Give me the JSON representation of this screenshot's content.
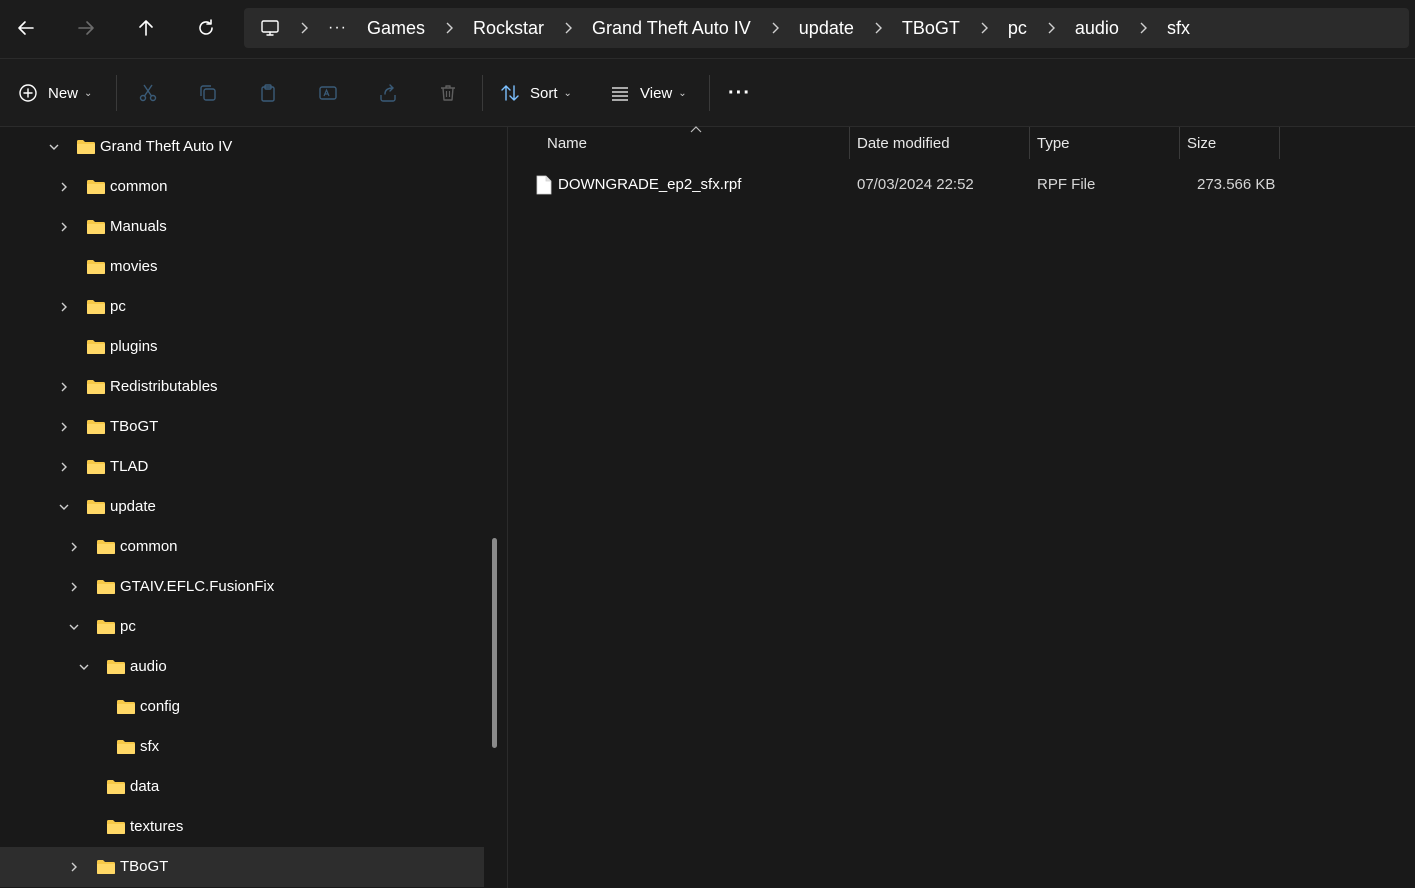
{
  "breadcrumb": {
    "more": "···",
    "items": [
      "Games",
      "Rockstar",
      "Grand Theft Auto IV",
      "update",
      "TBoGT",
      "pc",
      "audio",
      "sfx"
    ]
  },
  "toolbar": {
    "new_label": "New",
    "sort_label": "Sort",
    "view_label": "View",
    "more_label": "···"
  },
  "tree": [
    {
      "label": "Grand Theft Auto IV",
      "state": "expanded"
    },
    {
      "label": "common",
      "state": "collapsed"
    },
    {
      "label": "Manuals",
      "state": "collapsed"
    },
    {
      "label": "movies",
      "state": "none"
    },
    {
      "label": "pc",
      "state": "collapsed"
    },
    {
      "label": "plugins",
      "state": "none"
    },
    {
      "label": "Redistributables",
      "state": "collapsed"
    },
    {
      "label": "TBoGT",
      "state": "collapsed"
    },
    {
      "label": "TLAD",
      "state": "collapsed"
    },
    {
      "label": "update",
      "state": "expanded"
    },
    {
      "label": "common",
      "state": "collapsed"
    },
    {
      "label": "GTAIV.EFLC.FusionFix",
      "state": "collapsed"
    },
    {
      "label": "pc",
      "state": "expanded"
    },
    {
      "label": "audio",
      "state": "expanded"
    },
    {
      "label": "config",
      "state": "none"
    },
    {
      "label": "sfx",
      "state": "none"
    },
    {
      "label": "data",
      "state": "none"
    },
    {
      "label": "textures",
      "state": "none"
    },
    {
      "label": "TBoGT",
      "state": "collapsed",
      "selected": true
    }
  ],
  "columns": {
    "name": "Name",
    "date": "Date modified",
    "type": "Type",
    "size": "Size"
  },
  "files": [
    {
      "name": "DOWNGRADE_ep2_sfx.rpf",
      "date": "07/03/2024 22:52",
      "type": "RPF File",
      "size": "273.566 KB"
    }
  ],
  "colors": {
    "background": "#191919",
    "folder": "#f7c948",
    "selected_row": "#2d2d2d",
    "breadcrumb_bg": "#2b2b2b"
  }
}
